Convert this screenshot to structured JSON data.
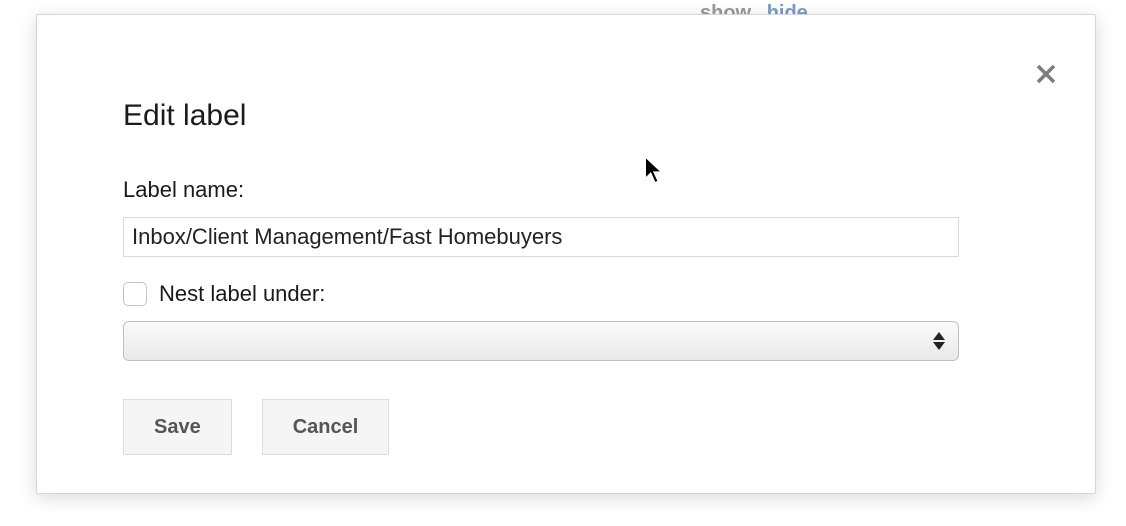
{
  "background": {
    "show_label": "show",
    "hide_label": "hide"
  },
  "dialog": {
    "title": "Edit label",
    "label_name_label": "Label name:",
    "label_name_value": "Inbox/Client Management/Fast Homebuyers",
    "nest_checkbox_checked": false,
    "nest_label": "Nest label under:",
    "nest_select_value": "",
    "save_label": "Save",
    "cancel_label": "Cancel"
  }
}
